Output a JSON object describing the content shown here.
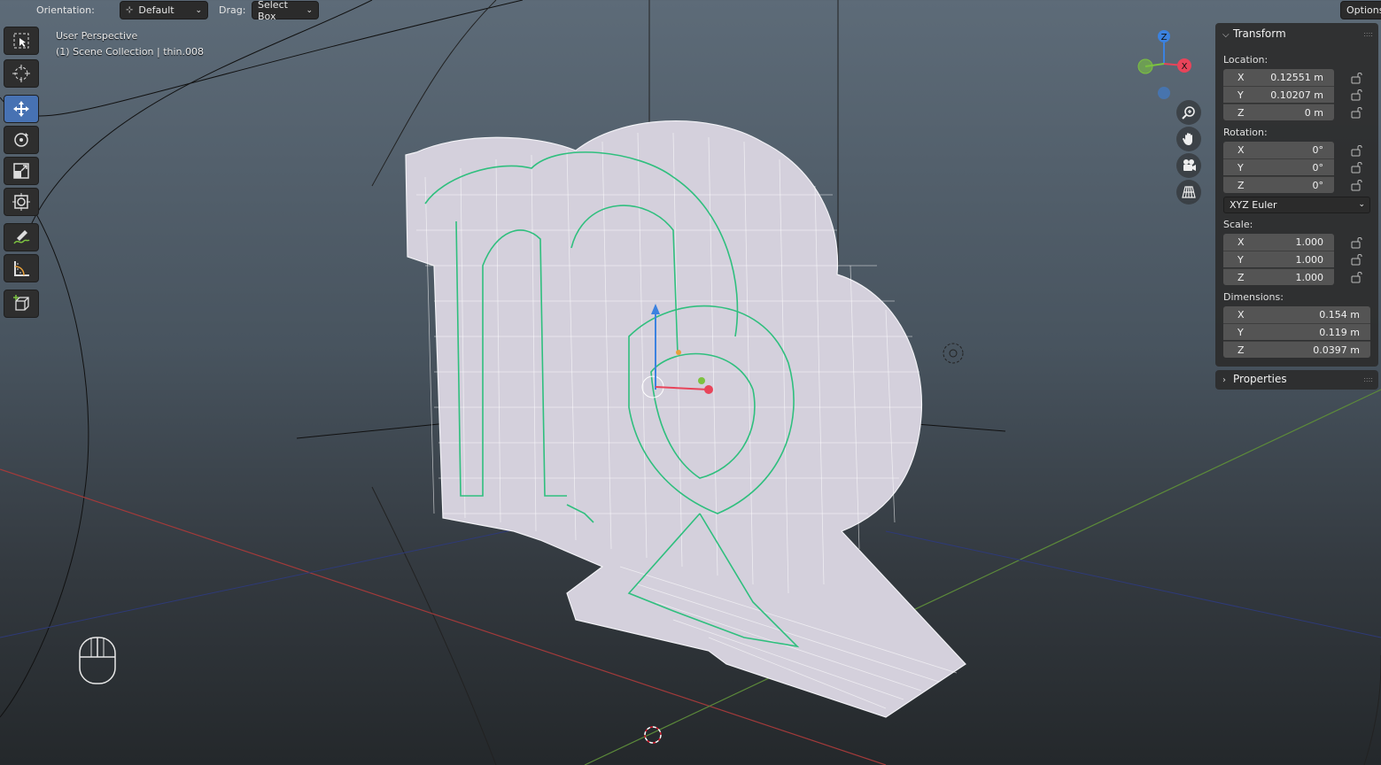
{
  "header": {
    "orientation_label": "Orientation:",
    "orientation_value": "Default",
    "drag_label": "Drag:",
    "drag_value": "Select Box",
    "options_label": "Options"
  },
  "toolbar": {
    "tools": [
      {
        "name": "select-box-icon",
        "active": false
      },
      {
        "name": "cursor-icon",
        "active": false
      },
      {
        "name": "move-icon",
        "active": true
      },
      {
        "name": "rotate-icon",
        "active": false
      },
      {
        "name": "scale-icon",
        "active": false
      },
      {
        "name": "transform-icon",
        "active": false
      },
      {
        "name": "annotate-icon",
        "active": false
      },
      {
        "name": "measure-icon",
        "active": false
      },
      {
        "name": "add-cube-icon",
        "active": false
      }
    ]
  },
  "viewport": {
    "perspective": "User Perspective",
    "collection": "(1) Scene Collection | thin.008"
  },
  "gizmo": {
    "z_label": "Z",
    "x_label": "X",
    "colors": {
      "x": "#e8445a",
      "y": "#7cc240",
      "z": "#3b82e0"
    }
  },
  "transform_panel": {
    "title": "Transform",
    "location_label": "Location:",
    "location": [
      {
        "axis": "X",
        "value": "0.12551 m"
      },
      {
        "axis": "Y",
        "value": "0.10207 m"
      },
      {
        "axis": "Z",
        "value": "0 m"
      }
    ],
    "rotation_label": "Rotation:",
    "rotation": [
      {
        "axis": "X",
        "value": "0°"
      },
      {
        "axis": "Y",
        "value": "0°"
      },
      {
        "axis": "Z",
        "value": "0°"
      }
    ],
    "rotation_mode": "XYZ Euler",
    "scale_label": "Scale:",
    "scale": [
      {
        "axis": "X",
        "value": "1.000"
      },
      {
        "axis": "Y",
        "value": "1.000"
      },
      {
        "axis": "Z",
        "value": "1.000"
      }
    ],
    "dimensions_label": "Dimensions:",
    "dimensions": [
      {
        "axis": "X",
        "value": "0.154 m"
      },
      {
        "axis": "Y",
        "value": "0.119 m"
      },
      {
        "axis": "Z",
        "value": "0.0397 m"
      }
    ]
  },
  "properties_panel": {
    "title": "Properties"
  }
}
